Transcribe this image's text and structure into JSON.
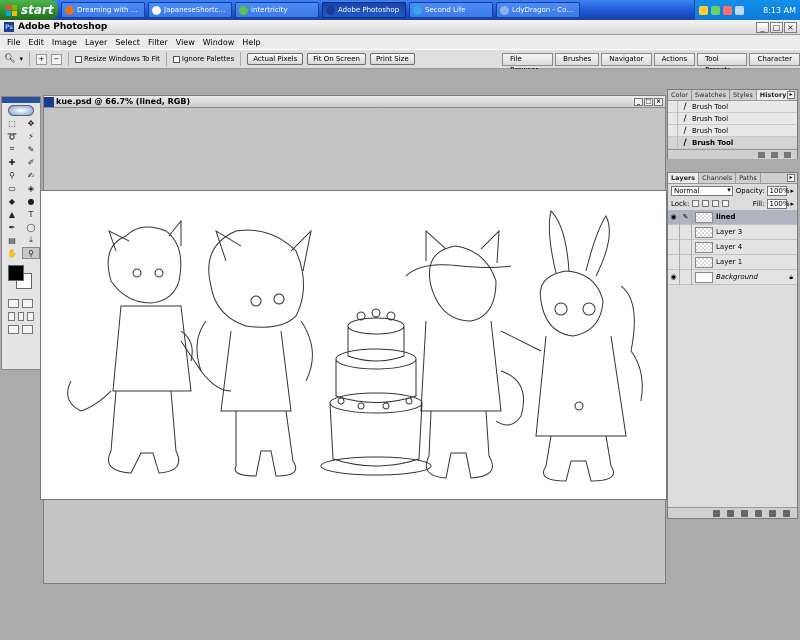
{
  "taskbar": {
    "start_label": "start",
    "tasks": [
      {
        "label": "Dreaming with a ...",
        "color": "#e8731f"
      },
      {
        "label": "JapaneseShortca...",
        "color": "#f6f6f6"
      },
      {
        "label": "intertricity",
        "color": "#5ec04a"
      },
      {
        "label": "Adobe Photoshop",
        "color": "#1b3d8f"
      },
      {
        "label": "Second Life",
        "color": "#3aa3e8"
      },
      {
        "label": "LdyDragon - Con...",
        "color": "#8fb3e8"
      }
    ],
    "clock": "8:13 AM"
  },
  "app": {
    "title": "Adobe Photoshop",
    "menu": [
      "File",
      "Edit",
      "Image",
      "Layer",
      "Select",
      "Filter",
      "View",
      "Window",
      "Help"
    ]
  },
  "options": {
    "resize_label": "Resize Windows To Fit",
    "ignore_label": "Ignore Palettes",
    "actual_pixels": "Actual Pixels",
    "fit_on_screen": "Fit On Screen",
    "print_size": "Print Size"
  },
  "palette_well": [
    "File Browser",
    "Brushes",
    "Navigator",
    "Actions",
    "Tool Presets",
    "Character"
  ],
  "document": {
    "title": "kue.psd @ 66.7% (lined, RGB)"
  },
  "history": {
    "tabs": [
      "Color",
      "Swatches",
      "Styles",
      "History"
    ],
    "active_tab": "History",
    "items": [
      "Brush Tool",
      "Brush Tool",
      "Brush Tool",
      "Brush Tool"
    ]
  },
  "layers": {
    "tabs": [
      "Layers",
      "Channels",
      "Paths"
    ],
    "blend_mode": "Normal",
    "opacity_label": "Opacity:",
    "opacity": "100%",
    "lock_label": "Lock:",
    "fill_label": "Fill:",
    "fill": "100%",
    "items": [
      {
        "name": "lined",
        "visible": true,
        "active": true
      },
      {
        "name": "Layer 3",
        "visible": false,
        "active": false
      },
      {
        "name": "Layer 4",
        "visible": false,
        "active": false
      },
      {
        "name": "Layer 1",
        "visible": false,
        "active": false
      },
      {
        "name": "Background",
        "visible": true,
        "active": false,
        "background": true
      }
    ]
  }
}
